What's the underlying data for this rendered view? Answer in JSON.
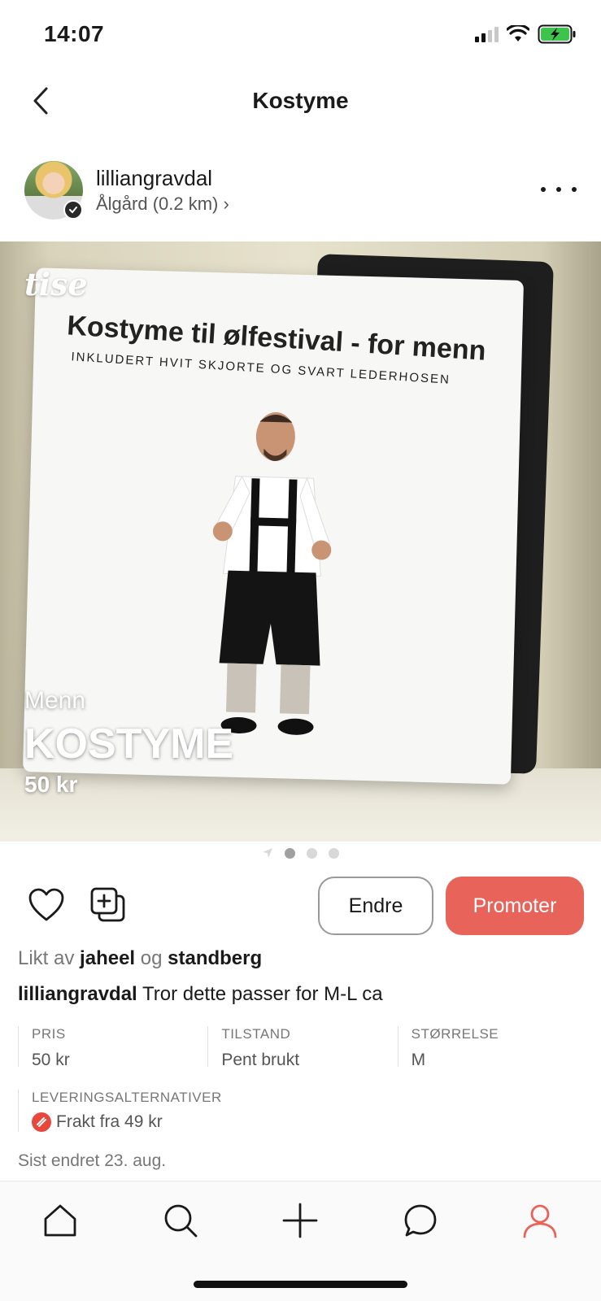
{
  "status_bar": {
    "time": "14:07",
    "icons": [
      "signal-icon",
      "wifi-icon",
      "battery-charging-icon"
    ]
  },
  "nav": {
    "title": "Kostyme",
    "back_icon": "chevron-left-icon"
  },
  "seller": {
    "username": "lilliangravdal",
    "location": "Ålgård (0.2 km) ›",
    "more_icon": "ellipsis-icon"
  },
  "hero": {
    "watermark": "tise",
    "package_title": "Kostyme til ølfestival - for menn",
    "package_subtitle": "INKLUDERT HVIT SKJORTE OG SVART LEDERHOSEN",
    "category": "Menn",
    "title": "KOSTYME",
    "price": "50 kr"
  },
  "pager": {
    "count": 3,
    "active_index": 0
  },
  "actions": {
    "edit_label": "Endre",
    "promote_label": "Promoter",
    "promote_color": "#e8635a"
  },
  "likes": {
    "prefix": "Likt av",
    "user1": "jaheel",
    "joiner": "og",
    "user2": "standberg"
  },
  "description": {
    "username": "lilliangravdal",
    "text": "Tror dette passer for M-L ca"
  },
  "specs": [
    {
      "label": "PRIS",
      "value": "50 kr"
    },
    {
      "label": "TILSTAND",
      "value": "Pent brukt"
    },
    {
      "label": "STØRRELSE",
      "value": "M"
    }
  ],
  "delivery": {
    "label": "LEVERINGSALTERNATIVER",
    "value": "Frakt fra 49 kr"
  },
  "updated": "Sist endret 23. aug.",
  "tabs": [
    {
      "name": "home-icon"
    },
    {
      "name": "search-icon"
    },
    {
      "name": "plus-icon"
    },
    {
      "name": "chat-icon"
    },
    {
      "name": "profile-icon",
      "active": true,
      "color": "#e8635a"
    }
  ]
}
